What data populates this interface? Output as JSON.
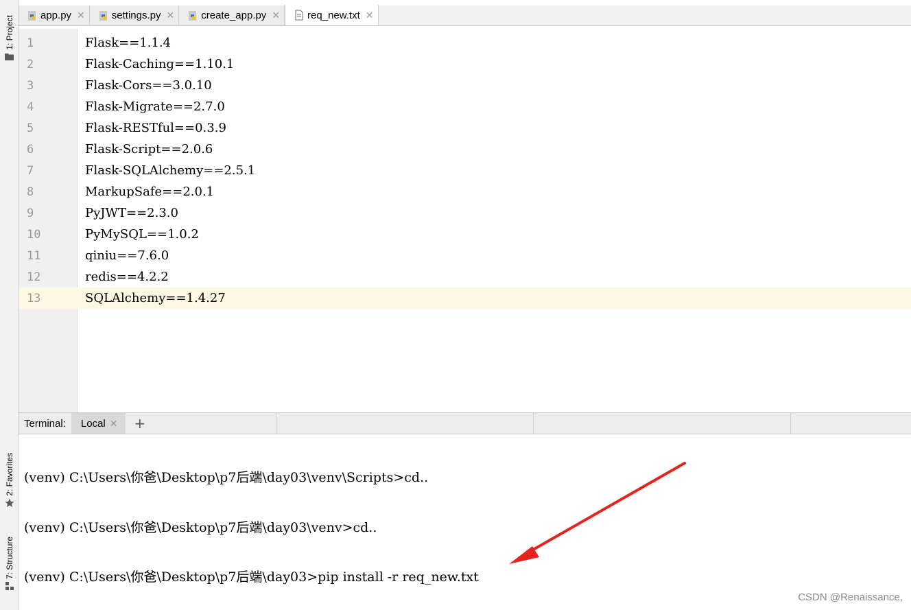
{
  "sidebar": {
    "project_label": "1: Project",
    "favorites_label": "2: Favorites",
    "structure_label": "7: Structure"
  },
  "tabs": [
    {
      "label": "app.py",
      "icon": "python-file-icon"
    },
    {
      "label": "settings.py",
      "icon": "python-file-icon"
    },
    {
      "label": "create_app.py",
      "icon": "python-file-icon"
    },
    {
      "label": "req_new.txt",
      "icon": "text-file-icon",
      "active": true
    }
  ],
  "editor": {
    "current_line": 13,
    "lines": [
      {
        "num": "1",
        "text": "Flask==1.1.4"
      },
      {
        "num": "2",
        "text": "Flask-Caching==1.10.1"
      },
      {
        "num": "3",
        "text": "Flask-Cors==3.0.10"
      },
      {
        "num": "4",
        "text": "Flask-Migrate==2.7.0"
      },
      {
        "num": "5",
        "text": "Flask-RESTful==0.3.9"
      },
      {
        "num": "6",
        "text": "Flask-Script==2.0.6"
      },
      {
        "num": "7",
        "text": "Flask-SQLAlchemy==2.5.1"
      },
      {
        "num": "8",
        "text": "MarkupSafe==2.0.1"
      },
      {
        "num": "9",
        "text": "PyJWT==2.3.0"
      },
      {
        "num": "10",
        "text": "PyMySQL==1.0.2"
      },
      {
        "num": "11",
        "text": "qiniu==7.6.0"
      },
      {
        "num": "12",
        "text": "redis==4.2.2"
      },
      {
        "num": "13",
        "text": "SQLAlchemy==1.4.27"
      }
    ]
  },
  "terminal": {
    "title": "Terminal:",
    "tab_label": "Local",
    "add_label": "+",
    "lines": [
      "(venv) C:\\Users\\你爸\\Desktop\\p7后端\\day03\\venv\\Scripts>cd..",
      "(venv) C:\\Users\\你爸\\Desktop\\p7后端\\day03\\venv>cd..",
      "(venv) C:\\Users\\你爸\\Desktop\\p7后端\\day03>pip install -r req_new.txt"
    ]
  },
  "watermark": "CSDN @Renaissance,",
  "colors": {
    "arrow": "#e8231d",
    "current_line": "#fdf8e2",
    "gutter": "#f0f0f0"
  }
}
